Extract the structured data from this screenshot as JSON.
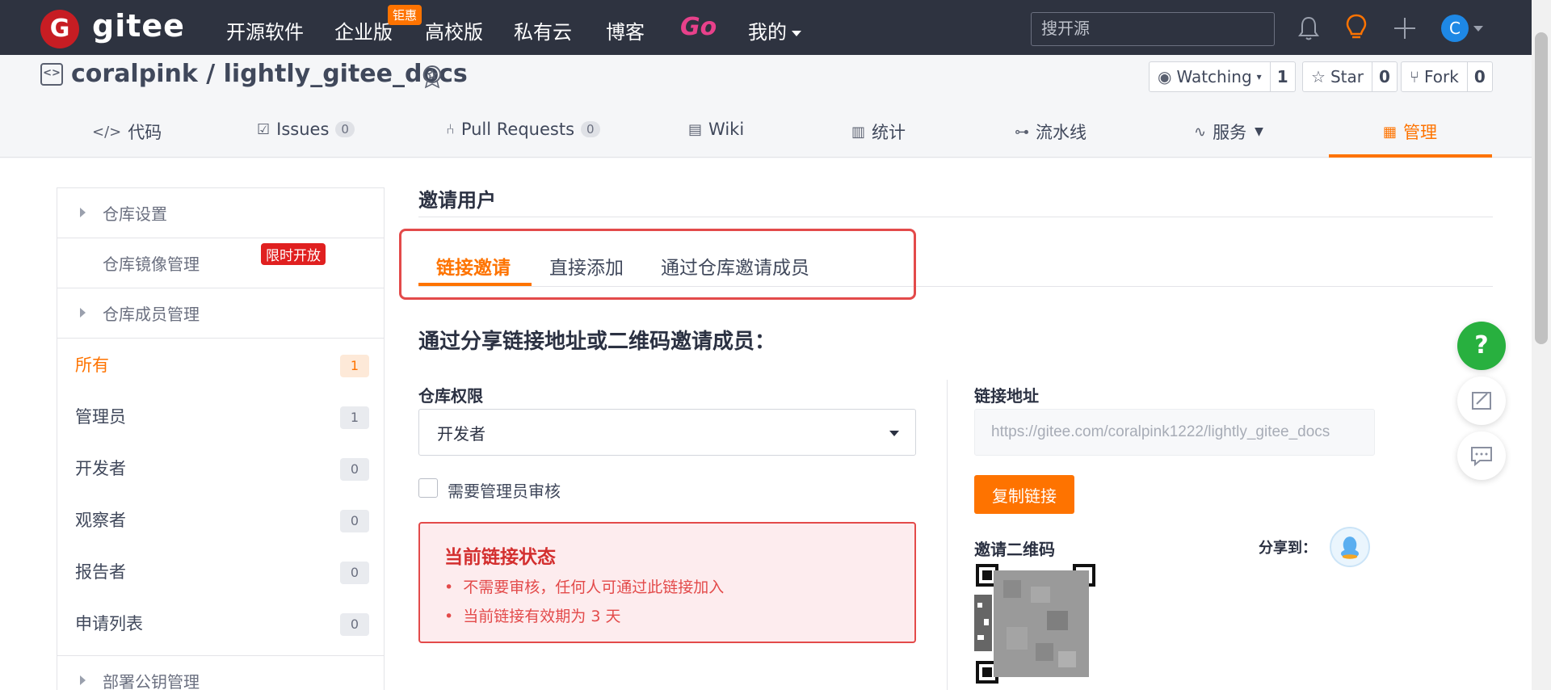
{
  "topnav": {
    "logo_letter": "G",
    "logo_text": "gitee",
    "items": [
      "开源软件",
      "企业版",
      "高校版",
      "私有云",
      "博客"
    ],
    "promo_badge": "钜惠",
    "go_label": "Go",
    "mine_label": "我的",
    "search_placeholder": "搜开源",
    "avatar_letter": "C"
  },
  "repo": {
    "title": "coralpink / lightly_gitee_docs",
    "watching_label": "Watching",
    "watching_count": "1",
    "star_label": "Star",
    "star_count": "0",
    "fork_label": "Fork",
    "fork_count": "0"
  },
  "tabs": {
    "code": "代码",
    "issues": "Issues",
    "issues_count": "0",
    "pulls": "Pull Requests",
    "pulls_count": "0",
    "wiki": "Wiki",
    "stats": "统计",
    "pipeline": "流水线",
    "service": "服务",
    "manage": "管理"
  },
  "sidebar": {
    "repo_settings": "仓库设置",
    "mirror_manage": "仓库镜像管理",
    "limited_badge": "限时开放",
    "member_manage": "仓库成员管理",
    "members": [
      {
        "label": "所有",
        "count": "1"
      },
      {
        "label": "管理员",
        "count": "1"
      },
      {
        "label": "开发者",
        "count": "0"
      },
      {
        "label": "观察者",
        "count": "0"
      },
      {
        "label": "报告者",
        "count": "0"
      },
      {
        "label": "申请列表",
        "count": "0"
      }
    ],
    "deploy_keys": "部署公钥管理"
  },
  "content": {
    "title": "邀请用户",
    "sub_tabs": [
      "链接邀请",
      "直接添加",
      "通过仓库邀请成员"
    ],
    "heading": "通过分享链接地址或二维码邀请成员：",
    "perm_label": "仓库权限",
    "perm_value": "开发者",
    "review_checkbox_label": "需要管理员审核",
    "status_title": "当前链接状态",
    "status_items": [
      "不需要审核，任何人可通过此链接加入",
      "当前链接有效期为 3 天"
    ],
    "link_label": "链接地址",
    "link_value": "https://gitee.com/coralpink1222/lightly_gitee_docs",
    "copy_button": "复制链接",
    "qr_label": "邀请二维码",
    "share_label": "分享到："
  },
  "colors": {
    "accent": "#fe7300",
    "nav_bg": "#2e3340",
    "alert_red": "#e34a4a",
    "help_green": "#28b03f"
  }
}
